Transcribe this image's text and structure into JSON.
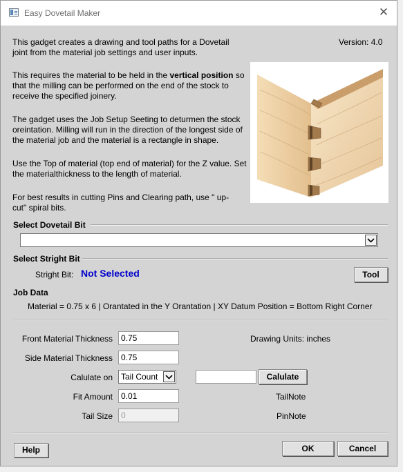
{
  "window": {
    "title": "Easy Dovetail Maker",
    "close_glyph": "✕"
  },
  "intro": {
    "version": "Version: 4.0",
    "para1": "This gadget creates a drawing and tool paths for a Dovetail joint from the material job settings and user inputs.",
    "para2_prefix": "This requires the material to be held in the ",
    "para2_bold": "vertical position",
    "para2_suffix": " so that the milling can be performed on the end of the stock to receive the specified joinery.",
    "para3": "The gadget uses the Job Setup Seeting to deturmen the stock oreintation. Milling will run in the direction of the longest side of the material job and the material is a rectangle in shape.",
    "para4": "Use the Top of material (top end of material) for the Z value. Set the materialthickness to the length of material.",
    "para5": "For best results in cutting Pins and Clearing path, use \" up-cut\" spiral bits."
  },
  "dovetail_bit": {
    "section": "Select Dovetail Bit",
    "value": ""
  },
  "stright_bit": {
    "section": "Select Stright Bit",
    "label": "Stright Bit:",
    "value": "Not Selected",
    "value_color": "#0000cc",
    "tool_button": "Tool"
  },
  "job_data": {
    "section": "Job Data",
    "summary": "Material = 0.75 x 6 | Orantated in the Y Orantation | XY Datum Position = Bottom Right Corner"
  },
  "form": {
    "front_label": "Front Material Thickness",
    "front_value": "0.75",
    "side_label": "Side Material Thickness",
    "side_value": "0.75",
    "calc_on_label": "Calulate on",
    "calc_on_value": "Tail Count",
    "calc_input_value": "",
    "calculate_button": "Calulate",
    "fit_label": "Fit Amount",
    "fit_value": "0.01",
    "tail_size_label": "Tail Size",
    "tail_size_value": "0",
    "drawing_units": "Drawing Units: inches",
    "tail_note": "TailNote",
    "pin_note": "PinNote"
  },
  "footer": {
    "help": "Help",
    "ok": "OK",
    "cancel": "Cancel"
  },
  "icons": {
    "close": "close-icon",
    "app": "app-icon",
    "dropdown": "chevron-down-icon"
  }
}
